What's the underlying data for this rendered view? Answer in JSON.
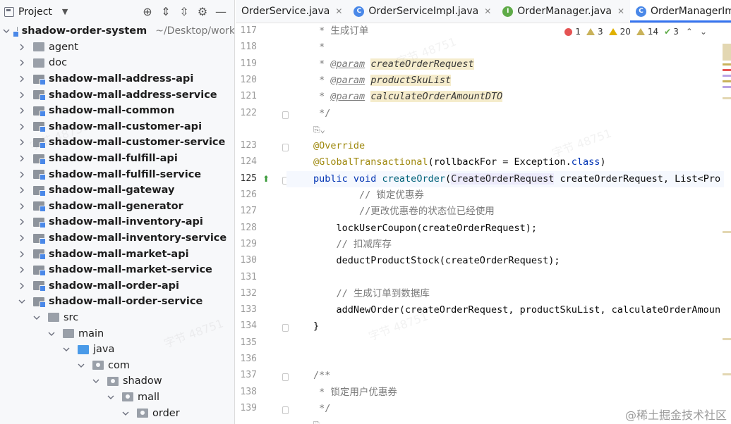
{
  "project_panel": {
    "title": "Project",
    "toolbar_icons": [
      "target-icon",
      "expand-all-icon",
      "collapse-all-icon",
      "gear-icon",
      "minimize-icon"
    ],
    "tree": [
      {
        "depth": 0,
        "expanded": true,
        "icon": "module",
        "label": "shadow-order-system",
        "bold": true,
        "path": "~/Desktop/work"
      },
      {
        "depth": 1,
        "expanded": false,
        "icon": "plain",
        "label": "agent",
        "bold": false
      },
      {
        "depth": 1,
        "expanded": false,
        "icon": "plain",
        "label": "doc",
        "bold": false
      },
      {
        "depth": 1,
        "expanded": false,
        "icon": "module",
        "label": "shadow-mall-address-api",
        "bold": true
      },
      {
        "depth": 1,
        "expanded": false,
        "icon": "module",
        "label": "shadow-mall-address-service",
        "bold": true
      },
      {
        "depth": 1,
        "expanded": false,
        "icon": "module",
        "label": "shadow-mall-common",
        "bold": true
      },
      {
        "depth": 1,
        "expanded": false,
        "icon": "module",
        "label": "shadow-mall-customer-api",
        "bold": true
      },
      {
        "depth": 1,
        "expanded": false,
        "icon": "module",
        "label": "shadow-mall-customer-service",
        "bold": true
      },
      {
        "depth": 1,
        "expanded": false,
        "icon": "module",
        "label": "shadow-mall-fulfill-api",
        "bold": true
      },
      {
        "depth": 1,
        "expanded": false,
        "icon": "module",
        "label": "shadow-mall-fulfill-service",
        "bold": true
      },
      {
        "depth": 1,
        "expanded": false,
        "icon": "module",
        "label": "shadow-mall-gateway",
        "bold": true
      },
      {
        "depth": 1,
        "expanded": false,
        "icon": "module",
        "label": "shadow-mall-generator",
        "bold": true
      },
      {
        "depth": 1,
        "expanded": false,
        "icon": "module",
        "label": "shadow-mall-inventory-api",
        "bold": true
      },
      {
        "depth": 1,
        "expanded": false,
        "icon": "module",
        "label": "shadow-mall-inventory-service",
        "bold": true
      },
      {
        "depth": 1,
        "expanded": false,
        "icon": "module",
        "label": "shadow-mall-market-api",
        "bold": true
      },
      {
        "depth": 1,
        "expanded": false,
        "icon": "module",
        "label": "shadow-mall-market-service",
        "bold": true
      },
      {
        "depth": 1,
        "expanded": false,
        "icon": "module",
        "label": "shadow-mall-order-api",
        "bold": true
      },
      {
        "depth": 1,
        "expanded": true,
        "icon": "module",
        "label": "shadow-mall-order-service",
        "bold": true
      },
      {
        "depth": 2,
        "expanded": true,
        "icon": "plain",
        "label": "src",
        "bold": false
      },
      {
        "depth": 3,
        "expanded": true,
        "icon": "plain",
        "label": "main",
        "bold": false
      },
      {
        "depth": 4,
        "expanded": true,
        "icon": "blue",
        "label": "java",
        "bold": false
      },
      {
        "depth": 5,
        "expanded": true,
        "icon": "pkg",
        "label": "com",
        "bold": false
      },
      {
        "depth": 6,
        "expanded": true,
        "icon": "pkg",
        "label": "shadow",
        "bold": false
      },
      {
        "depth": 7,
        "expanded": true,
        "icon": "pkg",
        "label": "mall",
        "bold": false
      },
      {
        "depth": 8,
        "expanded": true,
        "icon": "pkg",
        "label": "order",
        "bold": false
      }
    ]
  },
  "editor": {
    "tabs": [
      {
        "label": "OrderService.java",
        "kind": "none",
        "active": false
      },
      {
        "label": "OrderServiceImpl.java",
        "kind": "class",
        "active": false
      },
      {
        "label": "OrderManager.java",
        "kind": "iface",
        "active": false
      },
      {
        "label": "OrderManagerImpl.java",
        "kind": "class",
        "active": true
      }
    ],
    "inspection": {
      "errors": "1",
      "warnings_weak": "3",
      "warnings": "20",
      "weak": "14",
      "ok": "3"
    },
    "lines": [
      {
        "no": "117",
        "tokens": [
          {
            "t": " * 生成订单",
            "c": "c-comment"
          }
        ]
      },
      {
        "no": "118",
        "tokens": [
          {
            "t": " *",
            "c": "c-comment"
          }
        ]
      },
      {
        "no": "119",
        "tokens": [
          {
            "t": " * ",
            "c": "c-comment"
          },
          {
            "t": "@param",
            "c": "c-doc-tag"
          },
          {
            "t": " ",
            "c": "c-comment"
          },
          {
            "t": "createOrderRequest",
            "c": "c-param"
          }
        ]
      },
      {
        "no": "120",
        "tokens": [
          {
            "t": " * ",
            "c": "c-comment"
          },
          {
            "t": "@param",
            "c": "c-doc-tag"
          },
          {
            "t": " ",
            "c": "c-comment"
          },
          {
            "t": "productSkuList",
            "c": "c-param"
          }
        ]
      },
      {
        "no": "121",
        "tokens": [
          {
            "t": " * ",
            "c": "c-comment"
          },
          {
            "t": "@param",
            "c": "c-doc-tag"
          },
          {
            "t": " ",
            "c": "c-comment"
          },
          {
            "t": "calculateOrderAmountDTO",
            "c": "c-param"
          }
        ]
      },
      {
        "no": "122",
        "tokens": [
          {
            "t": " */",
            "c": "c-comment"
          }
        ]
      },
      {
        "no": "",
        "tokens": [
          {
            "t": "⎘⌄",
            "c": "c-inlay"
          }
        ]
      },
      {
        "no": "123",
        "tokens": [
          {
            "t": "@Override",
            "c": "c-ann"
          }
        ]
      },
      {
        "no": "124",
        "tokens": [
          {
            "t": "@GlobalTransactional",
            "c": "c-ann"
          },
          {
            "t": "(rollbackFor = Exception.",
            "c": "c-plain"
          },
          {
            "t": "class",
            "c": "c-kw"
          },
          {
            "t": ")",
            "c": "c-plain"
          }
        ]
      },
      {
        "no": "125",
        "current": true,
        "tokens": [
          {
            "t": "public void ",
            "c": "c-kw"
          },
          {
            "t": "createOrder",
            "c": "c-method"
          },
          {
            "t": "(",
            "c": "c-plain"
          },
          {
            "t": "CreateOrderRequest",
            "c": "c-type-hl"
          },
          {
            "t": " createOrderRequest, List<Pro",
            "c": "c-plain"
          }
        ]
      },
      {
        "no": "126",
        "tokens": [
          {
            "t": "        // 锁定优惠券",
            "c": "c-comment"
          }
        ]
      },
      {
        "no": "127",
        "tokens": [
          {
            "t": "        //更改优惠卷的状态位已经使用",
            "c": "c-comment"
          }
        ]
      },
      {
        "no": "128",
        "tokens": [
          {
            "t": "    lockUserCoupon(createOrderRequest);",
            "c": "c-plain"
          }
        ]
      },
      {
        "no": "129",
        "tokens": [
          {
            "t": "    // 扣减库存",
            "c": "c-comment"
          }
        ]
      },
      {
        "no": "130",
        "tokens": [
          {
            "t": "    deductProductStock(createOrderRequest);",
            "c": "c-plain"
          }
        ]
      },
      {
        "no": "131",
        "tokens": []
      },
      {
        "no": "132",
        "tokens": [
          {
            "t": "    // 生成订单到数据库",
            "c": "c-comment"
          }
        ]
      },
      {
        "no": "133",
        "tokens": [
          {
            "t": "    addNewOrder(createOrderRequest, productSkuList, calculateOrderAmoun",
            "c": "c-plain"
          }
        ]
      },
      {
        "no": "134",
        "tokens": [
          {
            "t": "}",
            "c": "c-plain"
          }
        ]
      },
      {
        "no": "135",
        "tokens": []
      },
      {
        "no": "136",
        "tokens": []
      },
      {
        "no": "137",
        "tokens": [
          {
            "t": "/**",
            "c": "c-comment"
          }
        ]
      },
      {
        "no": "138",
        "tokens": [
          {
            "t": " * 锁定用户优惠券",
            "c": "c-comment"
          }
        ]
      },
      {
        "no": "139",
        "tokens": [
          {
            "t": " */",
            "c": "c-comment"
          }
        ]
      },
      {
        "no": "",
        "tokens": [
          {
            "t": "⎘⌄",
            "c": "c-inlay"
          }
        ]
      }
    ]
  },
  "watermark": {
    "corner_text": "@稀土掘金技术社区",
    "repeat_text": "字节 48751"
  }
}
